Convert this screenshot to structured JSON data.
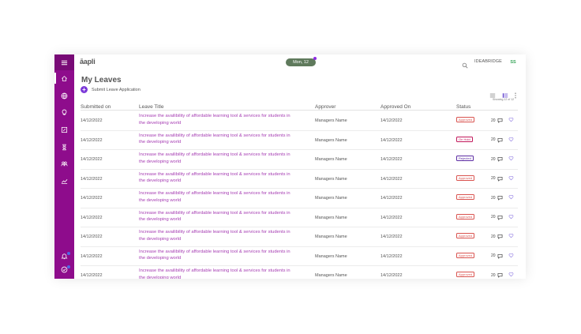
{
  "app": {
    "logo": "āapli",
    "date_pill": "Mon, 12",
    "company": "IDEABRIDGE",
    "user_initials": "SS"
  },
  "sidebar": {
    "items": [
      {
        "icon": "menu-icon"
      },
      {
        "icon": "home-icon"
      },
      {
        "icon": "globe-icon"
      },
      {
        "icon": "bulb-icon"
      },
      {
        "icon": "edit-icon"
      },
      {
        "icon": "hourglass-icon"
      },
      {
        "icon": "people-icon"
      },
      {
        "icon": "chart-icon"
      },
      {
        "icon": "bell-icon"
      },
      {
        "icon": "check-circle-icon"
      }
    ]
  },
  "page": {
    "title": "My Leaves",
    "submit_label": "Submit Leave Application",
    "showing_text": "Showing 12 of 12"
  },
  "table": {
    "columns": [
      "Submitted on",
      "Leave Title",
      "Approver",
      "Approved On",
      "Status"
    ],
    "rows": [
      {
        "submitted": "14/12/2022",
        "title": "Increase the availibility of affordable learning tool & services for students in the developing world",
        "approver": "Managers Name",
        "approved_on": "14/12/2022",
        "status": "Approved",
        "count": "20"
      },
      {
        "submitted": "14/12/2022",
        "title": "Increase the availibility of affordable learning tool & services for students in the developing world",
        "approver": "Managers Name",
        "approved_on": "14/12/2022",
        "status": "On Hold",
        "count": "20"
      },
      {
        "submitted": "14/12/2022",
        "title": "Increase the availibility of affordable learning tool & services for students in the developing world",
        "approver": "Managers Name",
        "approved_on": "14/12/2022",
        "status": "Rejected",
        "count": "20"
      },
      {
        "submitted": "14/12/2022",
        "title": "Increase the availibility of affordable learning tool & services for students in the developing world",
        "approver": "Managers Name",
        "approved_on": "14/12/2022",
        "status": "Approved",
        "count": "20"
      },
      {
        "submitted": "14/12/2022",
        "title": "Increase the availibility of affordable learning tool & services for students in the developing world",
        "approver": "Managers Name",
        "approved_on": "14/12/2022",
        "status": "Approved",
        "count": "20"
      },
      {
        "submitted": "14/12/2022",
        "title": "Increase the availibility of affordable learning tool & services for students in the developing world",
        "approver": "Managers Name",
        "approved_on": "14/12/2022",
        "status": "Approved",
        "count": "20"
      },
      {
        "submitted": "14/12/2022",
        "title": "Increase the availibility of affordable learning tool & services for students in the developing world",
        "approver": "Managers Name",
        "approved_on": "14/12/2022",
        "status": "Approved",
        "count": "20"
      },
      {
        "submitted": "14/12/2022",
        "title": "Increase the availibility of affordable learning tool & services for students in the developing world",
        "approver": "Managers Name",
        "approved_on": "14/12/2022",
        "status": "Approved",
        "count": "20"
      },
      {
        "submitted": "14/12/2022",
        "title": "Increase the availibility of affordable learning tool & services for students in the developing world",
        "approver": "Managers Name",
        "approved_on": "14/12/2022",
        "status": "Approved",
        "count": "20"
      }
    ]
  },
  "colors": {
    "brand": "#8e0c8c",
    "link": "#a63db3",
    "approved": "#d9534f",
    "on_hold": "#c2185b",
    "rejected": "#5c2ca3",
    "accent_button": "#7b38d8",
    "date_pill": "#5f7a5c",
    "initials": "#3aa65b"
  }
}
